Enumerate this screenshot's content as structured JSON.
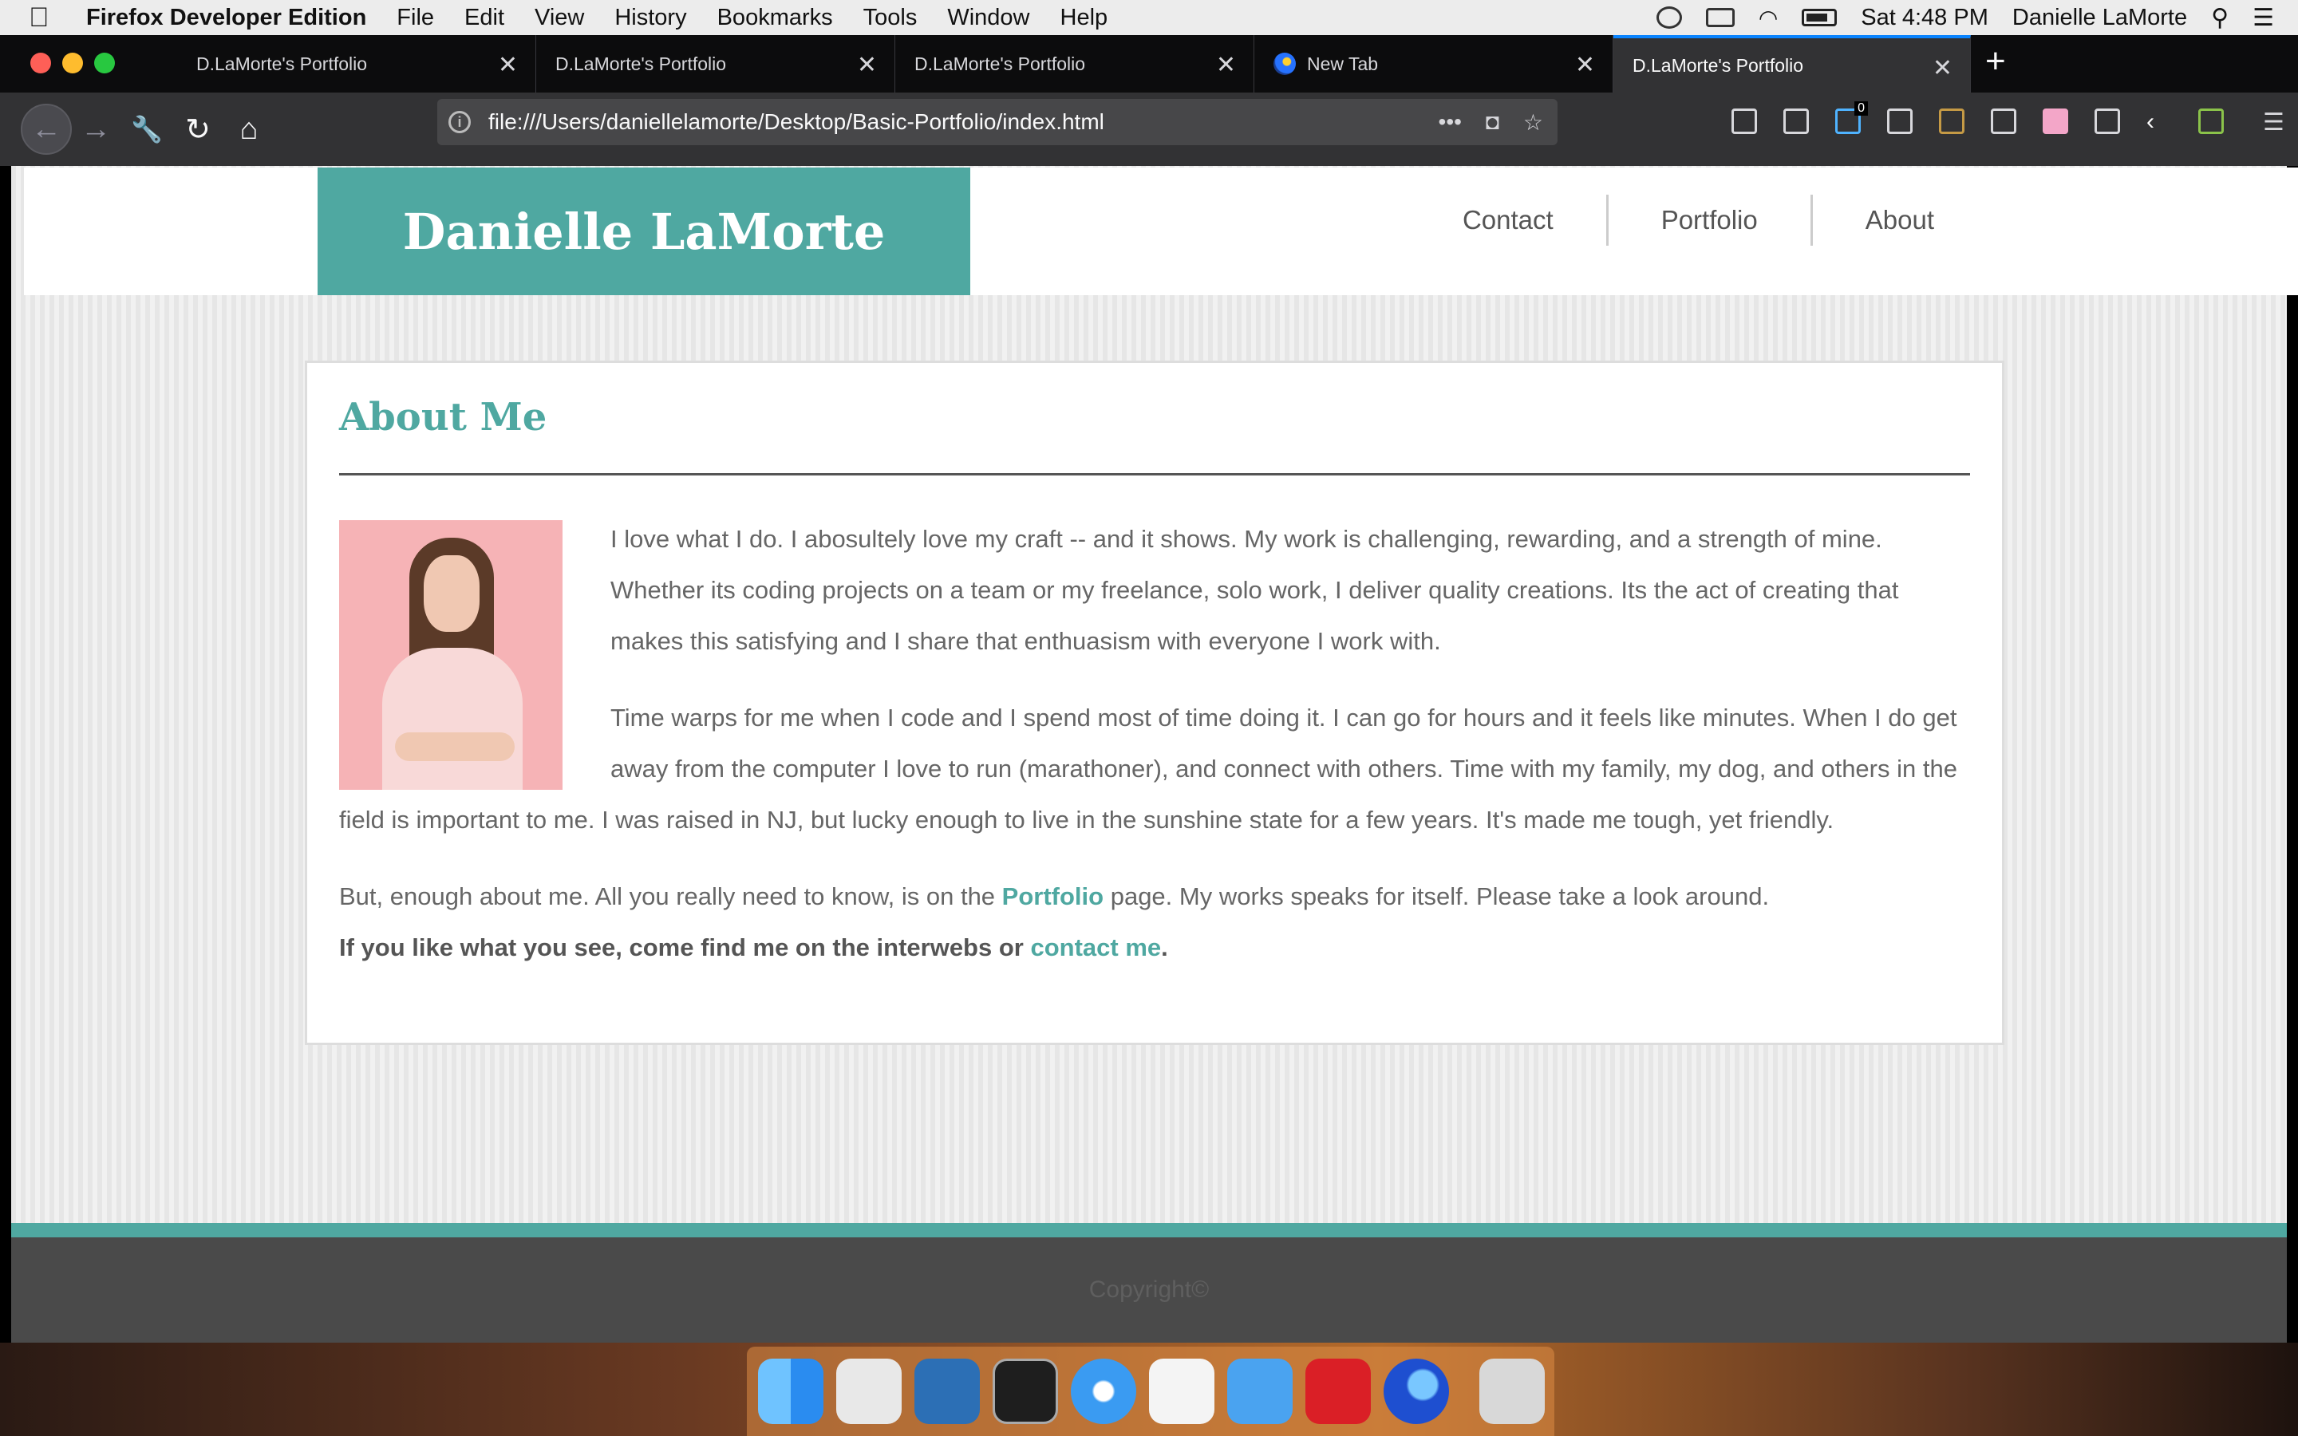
{
  "menubar": {
    "apple": "",
    "app_name": "Firefox Developer Edition",
    "items": [
      "File",
      "Edit",
      "View",
      "History",
      "Bookmarks",
      "Tools",
      "Window",
      "Help"
    ],
    "clock": "Sat 4:48 PM",
    "user": "Danielle LaMorte"
  },
  "tabs": [
    {
      "title": "D.LaMorte's Portfolio"
    },
    {
      "title": "D.LaMorte's Portfolio"
    },
    {
      "title": "D.LaMorte's Portfolio"
    },
    {
      "title": "New Tab"
    },
    {
      "title": "D.LaMorte's Portfolio",
      "active": true
    }
  ],
  "tab_close": "✕",
  "new_tab_label": "+",
  "navbar": {
    "url": "file:///Users/daniellelamorte/Desktop/Basic-Portfolio/index.html",
    "more": "•••",
    "badge_count": "0"
  },
  "site": {
    "brand": "Danielle LaMorte",
    "nav": [
      "Contact",
      "Portfolio",
      "About"
    ],
    "heading": "About Me",
    "p1": "I love what I do. I abosultely love my craft -- and it shows. My work is challenging, rewarding, and a strength of mine. Whether its coding projects on a team or my freelance, solo work, I deliver quality creations. Its the act of creating that makes this satisfying and I share that enthuasism with everyone I work with.",
    "p2": "Time warps for me when I code and I spend most of time doing it. I can go for hours and it feels like minutes. When I do get away from the computer I love to run (marathoner), and connect with others. Time with my family, my dog, and others in the field is important to me. I was raised in NJ, but lucky enough to live in the sunshine state for a few years. It's made me tough, yet friendly.",
    "p3_before": "But, enough about me. All you really need to know, is on the ",
    "p3_link": "Portfolio",
    "p3_after": " page. My works speaks for itself. Please take a look around.",
    "p4_text": "If you like what you see, come find me on the interwebs or ",
    "p4_link": "contact me",
    "p4_end": ".",
    "footer": "Copyright©"
  },
  "colors": {
    "brand_teal": "#4fa8a1",
    "footer_gray": "#4a4a4a",
    "tab_accent": "#0a84ff"
  },
  "dock_apps": [
    "Finder",
    "Preview",
    "Visual Studio Code",
    "Terminal",
    "Safari",
    "Slack",
    "Xcode",
    "Adobe Creative Cloud",
    "Firefox Developer Edition",
    "Trash"
  ]
}
